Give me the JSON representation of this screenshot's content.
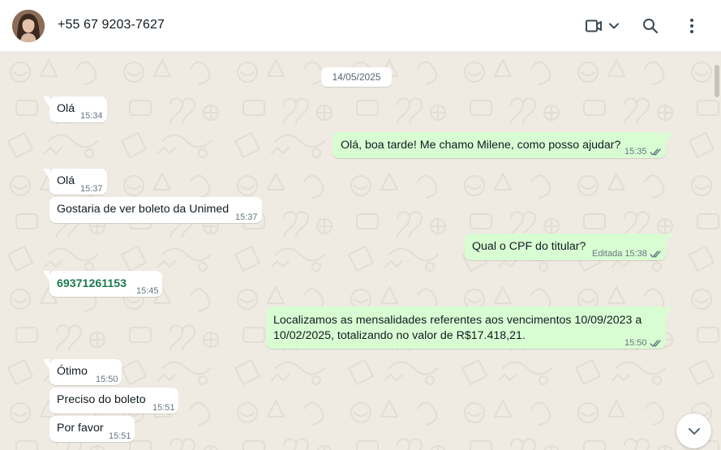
{
  "header": {
    "contact_name": "+55 67 9203-7627"
  },
  "chat": {
    "date_chip": "14/05/2025",
    "messages": [
      {
        "dir": "in",
        "text": "Olá",
        "time": "15:34"
      },
      {
        "dir": "out",
        "text": "Olá, boa tarde! Me chamo Milene, como posso ajudar?",
        "time": "15:35",
        "status": "read"
      },
      {
        "dir": "in",
        "text": "Olá",
        "time": "15:37"
      },
      {
        "dir": "in",
        "text": "Gostaria de ver boleto da Unimed",
        "time": "15:37"
      },
      {
        "dir": "out",
        "text": "Qual o CPF do titular?",
        "time": "15:38",
        "edited": "Editada",
        "status": "read"
      },
      {
        "dir": "in",
        "text": "69371261153",
        "time": "15:45",
        "is_phone_number": true
      },
      {
        "dir": "out",
        "text_line1": "Localizamos as mensalidades referentes aos vencimentos 10/09/2023 a",
        "text_line2": "10/02/2025, totalizando no valor de R$17.418,21.",
        "time": "15:50",
        "status": "read"
      },
      {
        "dir": "in",
        "text": "Ótimo",
        "time": "15:50"
      },
      {
        "dir": "in",
        "text": "Preciso do boleto",
        "time": "15:51"
      },
      {
        "dir": "in",
        "text": "Por favor",
        "time": "15:51"
      }
    ]
  },
  "colors": {
    "incoming_bubble": "#ffffff",
    "outgoing_bubble": "#d9fdd3",
    "chat_background": "#efeae2",
    "read_tick": "#667781",
    "phone_link": "#1d7a4f"
  },
  "icons": {
    "video_call": "video-camera-icon",
    "dropdown": "chevron-down-icon",
    "search": "search-icon",
    "menu": "kebab-menu-icon",
    "scroll_down": "chevron-down-icon"
  }
}
